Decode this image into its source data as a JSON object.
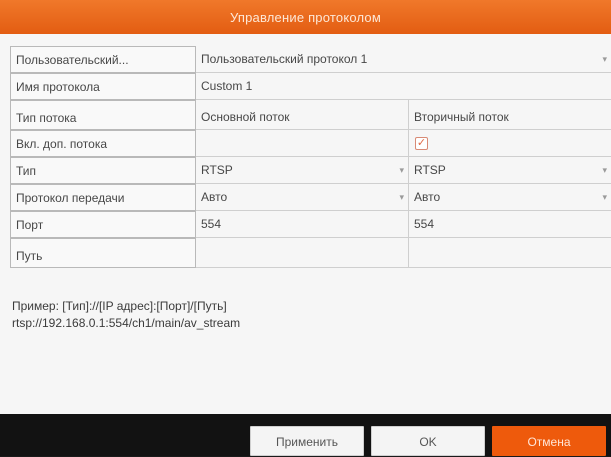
{
  "dialog": {
    "title": "Управление протоколом"
  },
  "fields": {
    "user_defined": {
      "label": "Пользовательский...",
      "value": "Пользовательский протокол 1"
    },
    "protocol_name": {
      "label": "Имя протокола",
      "value": "Custom 1"
    },
    "stream_type": {
      "label": "Тип потока",
      "main_header": "Основной поток",
      "sub_header": "Вторичный поток"
    },
    "enable_substream": {
      "label": "Вкл. доп. потока",
      "checked": true
    },
    "type": {
      "label": "Тип",
      "main_value": "RTSP",
      "sub_value": "RTSP"
    },
    "transfer_protocol": {
      "label": "Протокол передачи",
      "main_value": "Авто",
      "sub_value": "Авто"
    },
    "port": {
      "label": "Порт",
      "main_value": "554",
      "sub_value": "554"
    },
    "path": {
      "label": "Путь",
      "main_value": "",
      "sub_value": ""
    }
  },
  "example": {
    "line1": "Пример: [Тип]://[IP адрес]:[Порт]/[Путь]",
    "line2": "rtsp://192.168.0.1:554/ch1/main/av_stream"
  },
  "buttons": {
    "apply": "Применить",
    "ok": "OK",
    "cancel": "Отмена"
  },
  "icons": {
    "dropdown": "chevron-down-icon",
    "checkbox": "checkmark-icon"
  },
  "colors": {
    "accent": "#e8621a",
    "footer": "#121212"
  }
}
